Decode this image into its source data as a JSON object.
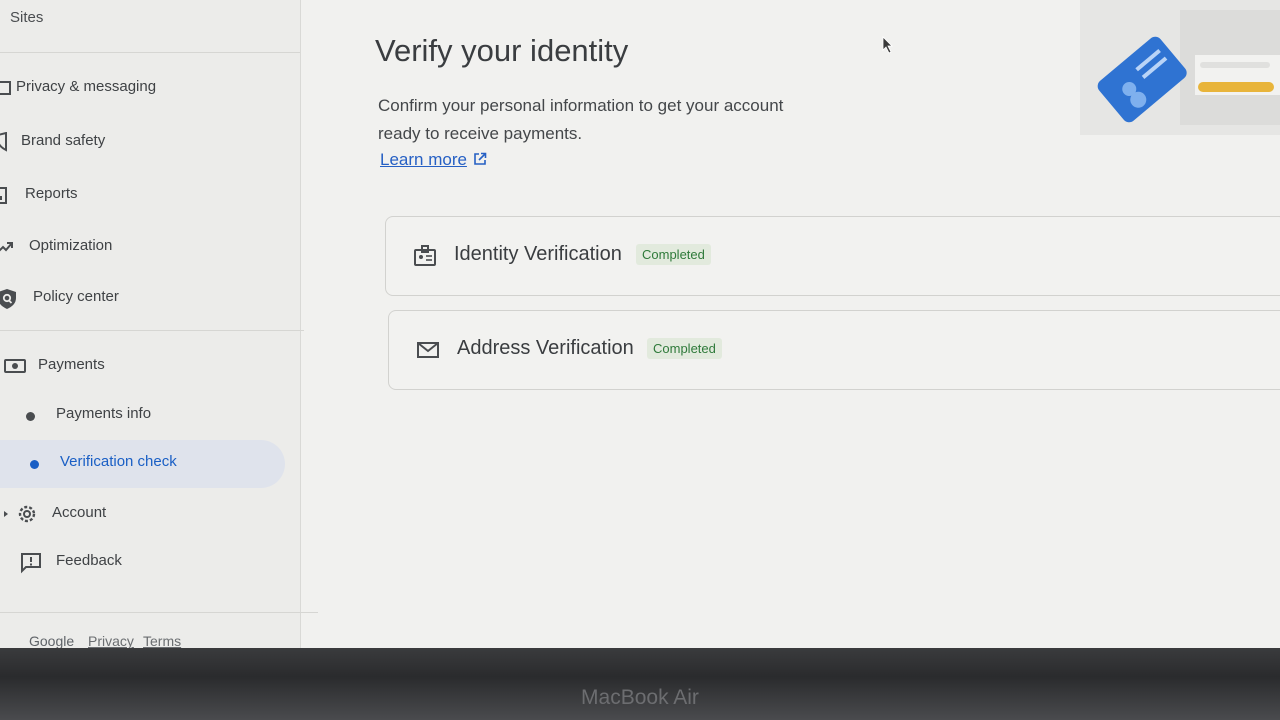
{
  "sidebar": {
    "sites_label": "Sites",
    "items": [
      {
        "label": "Privacy & messaging",
        "icon": "privacy-icon"
      },
      {
        "label": "Brand safety",
        "icon": "shield-icon"
      },
      {
        "label": "Reports",
        "icon": "reports-icon"
      },
      {
        "label": "Optimization",
        "icon": "trending-up-icon"
      },
      {
        "label": "Policy center",
        "icon": "policy-search-icon"
      }
    ],
    "payments": {
      "label": "Payments",
      "icon": "payments-icon",
      "sub_items": [
        {
          "label": "Payments info",
          "active": false
        },
        {
          "label": "Verification check",
          "active": true
        }
      ]
    },
    "account_label": "Account",
    "feedback_label": "Feedback",
    "footer": {
      "google": "Google",
      "privacy": "Privacy",
      "terms": "Terms"
    }
  },
  "main": {
    "title": "Verify your identity",
    "description": "Confirm your personal information to get your account ready to receive payments.",
    "learn_more": "Learn more",
    "cards": [
      {
        "title": "Identity Verification",
        "status": "Completed",
        "icon": "id-badge-icon"
      },
      {
        "title": "Address Verification",
        "status": "Completed",
        "icon": "mail-icon"
      }
    ]
  },
  "device_label": "MacBook Air",
  "colors": {
    "accent": "#1a5fc5",
    "badge_bg": "#e2eadd",
    "badge_text": "#2f7a3a"
  }
}
